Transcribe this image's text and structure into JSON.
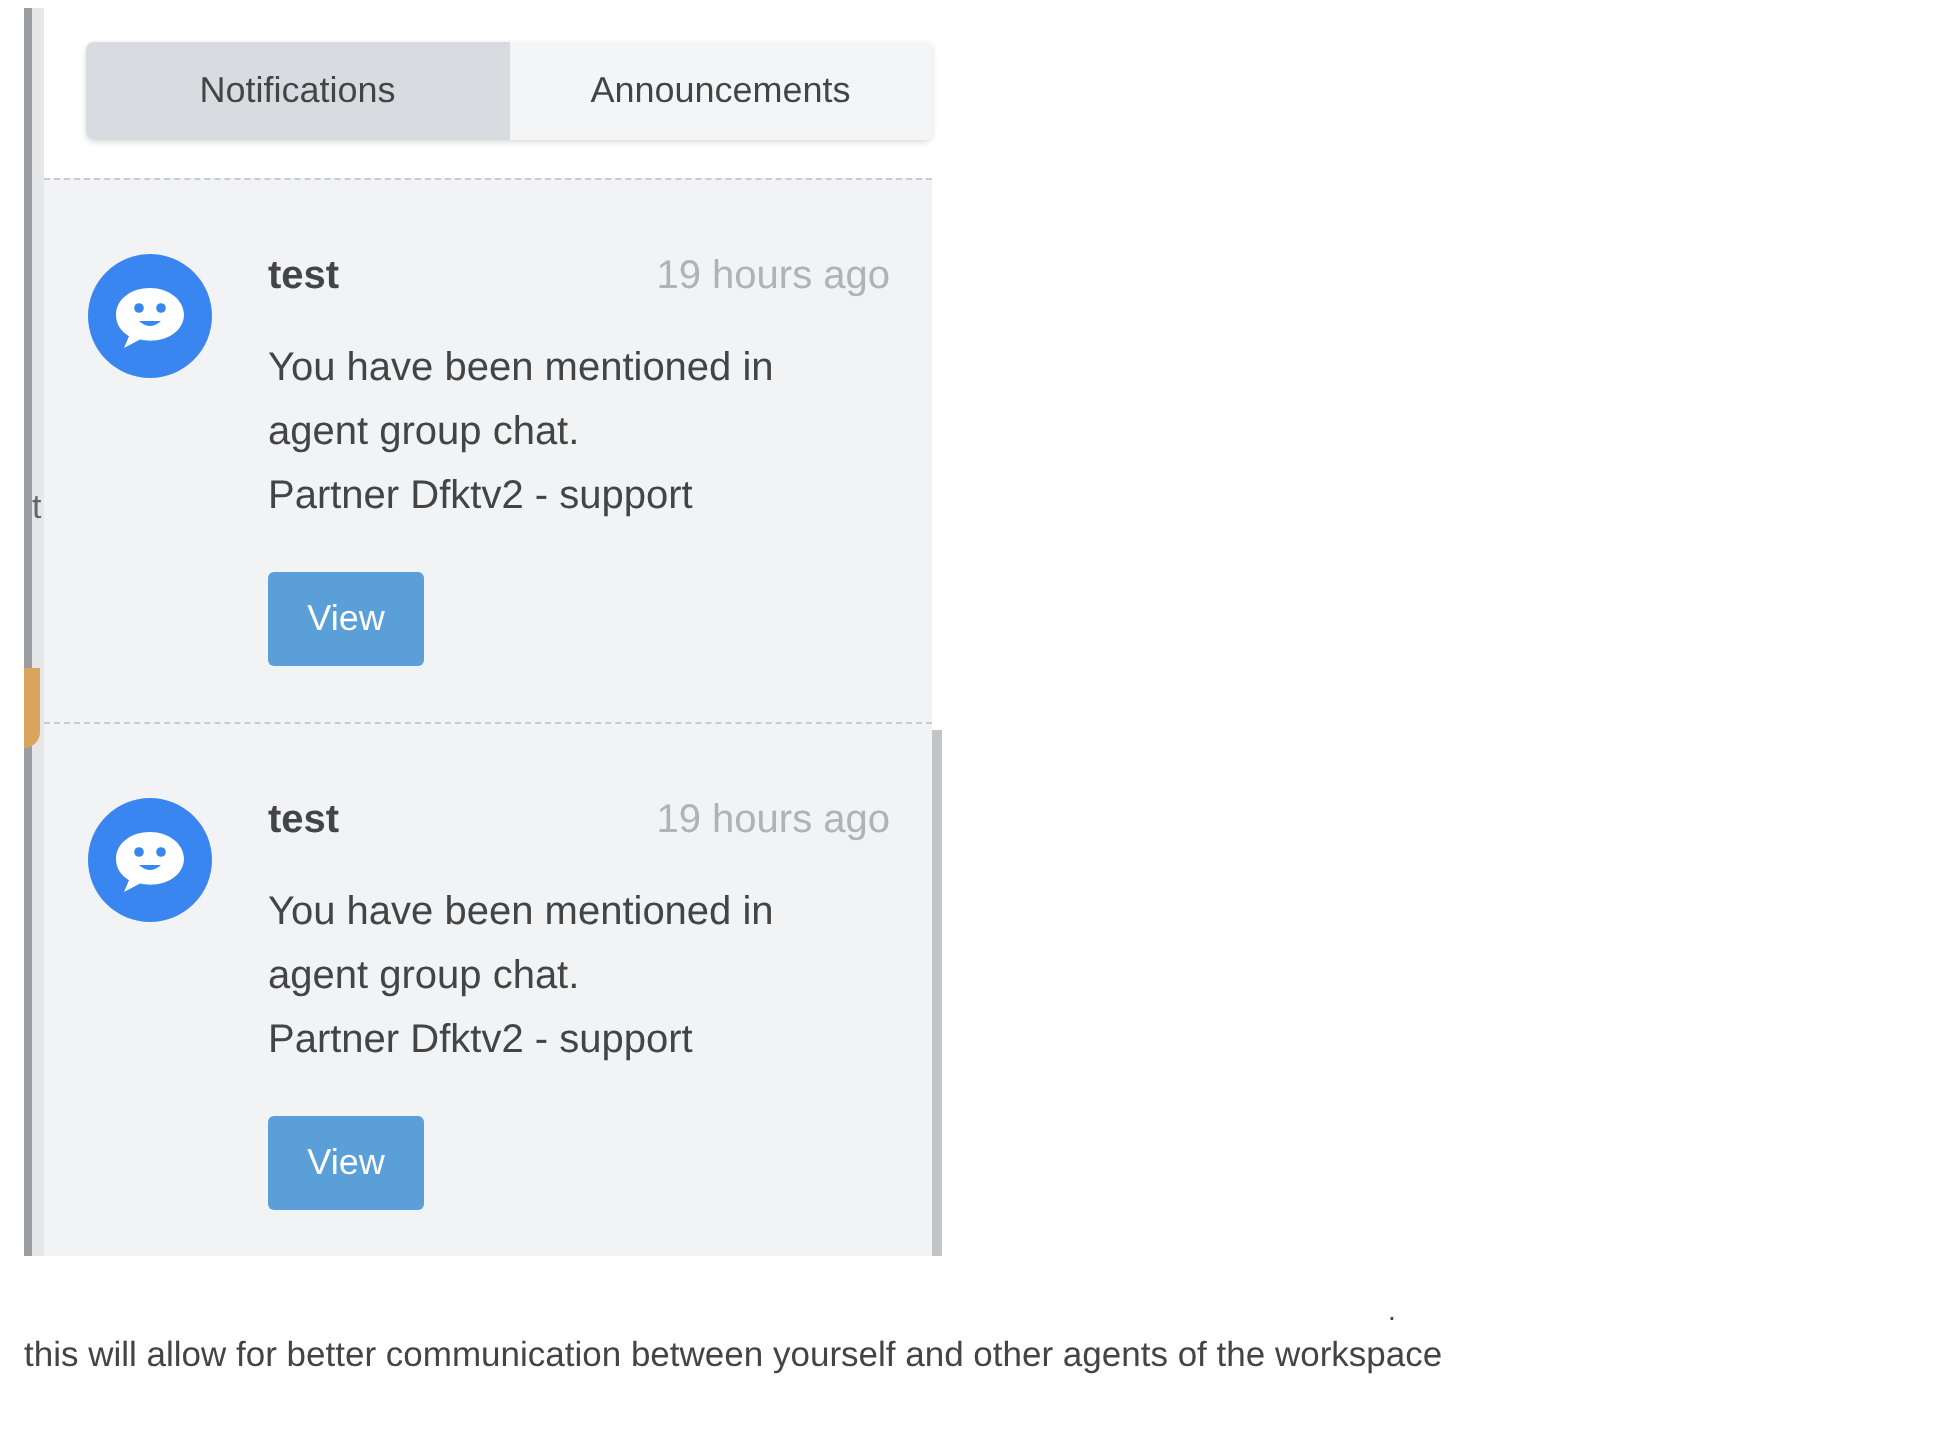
{
  "background_fragment": {
    "text": "t"
  },
  "tabs": [
    {
      "label": "Notifications",
      "selected": true
    },
    {
      "label": "Announcements",
      "selected": false
    }
  ],
  "notifications": [
    {
      "sender": "test",
      "time": "19 hours ago",
      "message": [
        "You have been mentioned in",
        "agent group chat.",
        "Partner Dfktv2 - support"
      ],
      "action": "View"
    },
    {
      "sender": "test",
      "time": "19 hours ago",
      "message": [
        "You have been mentioned in",
        "agent group chat.",
        "Partner Dfktv2 - support"
      ],
      "action": "View"
    }
  ],
  "stray_mark": ".",
  "caption": "this will allow for better communication between yourself and other agents of the workspace"
}
